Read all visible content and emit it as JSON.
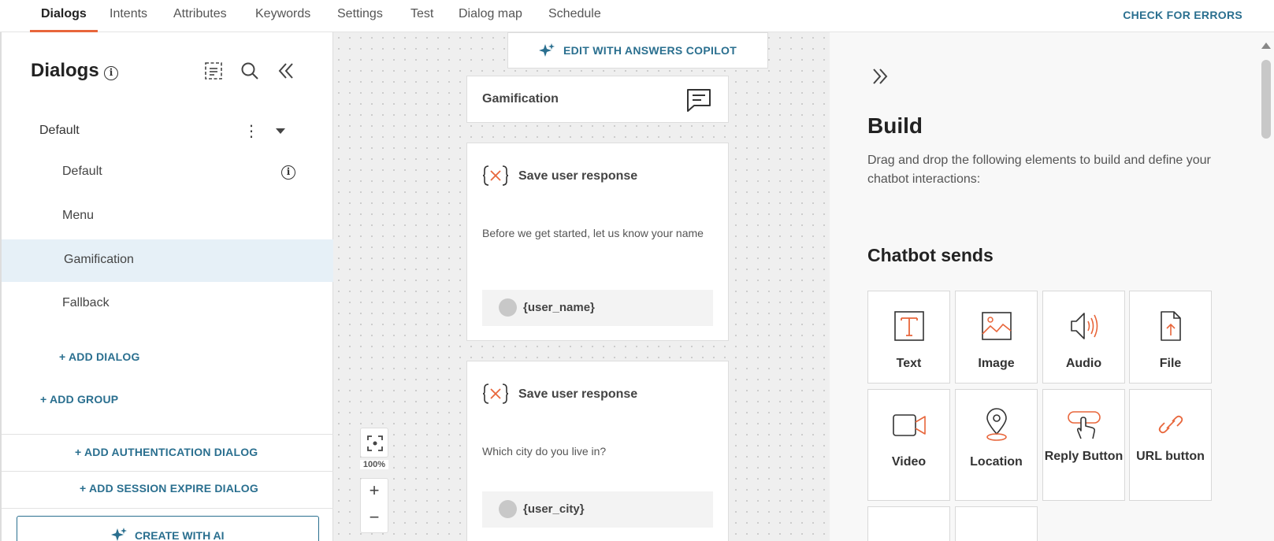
{
  "topnav": {
    "tabs": [
      {
        "label": "Dialogs",
        "active": true
      },
      {
        "label": "Intents",
        "active": false
      },
      {
        "label": "Attributes",
        "active": false
      },
      {
        "label": "Keywords",
        "active": false
      },
      {
        "label": "Settings",
        "active": false
      },
      {
        "label": "Test",
        "active": false
      },
      {
        "label": "Dialog map",
        "active": false
      },
      {
        "label": "Schedule",
        "active": false
      }
    ],
    "check_errors": "CHECK FOR ERRORS"
  },
  "sidebar": {
    "title": "Dialogs",
    "group": {
      "label": "Default",
      "dialogs": [
        {
          "label": "Default",
          "selected": false
        },
        {
          "label": "Menu",
          "selected": false
        },
        {
          "label": "Gamification",
          "selected": true
        },
        {
          "label": "Fallback",
          "selected": false
        }
      ],
      "add_dialog": "+ ADD DIALOG"
    },
    "add_group": "+ ADD GROUP",
    "add_auth_dialog": "+ ADD AUTHENTICATION DIALOG",
    "add_session_expire": "+ ADD SESSION EXPIRE DIALOG",
    "create_with_ai": "CREATE WITH AI"
  },
  "canvas": {
    "copilot_button": "EDIT WITH ANSWERS COPILOT",
    "dialog_name": "Gamification",
    "cards": [
      {
        "title": "Save user response",
        "text": "Before we get started, let us know your name",
        "attribute": "{user_name}"
      },
      {
        "title": "Save user response",
        "text": "Which city do you live in?",
        "attribute": "{user_city}"
      }
    ],
    "zoom_level": "100%",
    "zoom_in": "+",
    "zoom_out": "−"
  },
  "right_panel": {
    "title": "Build",
    "description": "Drag and drop the following elements to build and define your chatbot interactions:",
    "section_title": "Chatbot sends",
    "elements": [
      {
        "label": "Text",
        "icon": "text-icon"
      },
      {
        "label": "Image",
        "icon": "image-icon"
      },
      {
        "label": "Audio",
        "icon": "audio-icon"
      },
      {
        "label": "File",
        "icon": "file-icon"
      },
      {
        "label": "Video",
        "icon": "video-icon"
      },
      {
        "label": "Location",
        "icon": "location-icon"
      },
      {
        "label": "Reply Button",
        "icon": "reply-button-icon"
      },
      {
        "label": "URL button",
        "icon": "url-button-icon"
      }
    ]
  },
  "colors": {
    "accent": "#e8663b",
    "link": "#2a6f8f",
    "selected_bg": "#e6f0f7"
  }
}
